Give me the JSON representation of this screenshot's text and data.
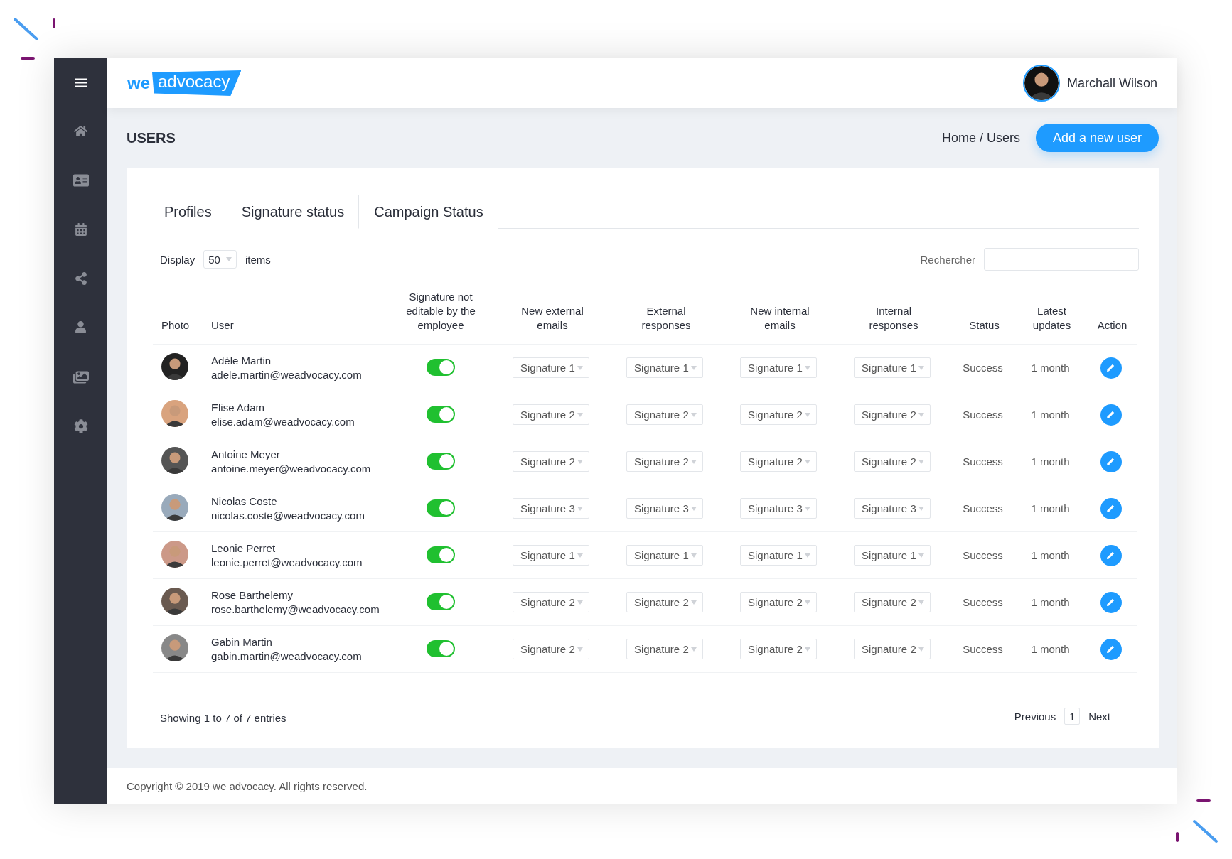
{
  "header": {
    "logo": {
      "part_1": "we",
      "part_2": "advocacy"
    },
    "user_name": "Marchall Wilson"
  },
  "page": {
    "title": "USERS",
    "breadcrumb": "Home / Users",
    "add_button": "Add a new user"
  },
  "tabs": [
    {
      "label": "Profiles",
      "selected": false
    },
    {
      "label": "Signature status",
      "selected": true
    },
    {
      "label": "Campaign Status",
      "selected": false
    }
  ],
  "display": {
    "label": "Display",
    "value": "50",
    "suffix": "items"
  },
  "search": {
    "label": "Rechercher"
  },
  "table": {
    "columns": [
      "Photo",
      "User",
      "Signature not editable by the employee",
      "New external emails",
      "External responses",
      "New internal emails",
      "Internal responses",
      "Status",
      "Latest updates",
      "Action"
    ],
    "rows": [
      {
        "name": "Adèle Martin",
        "email": "adele.martin@weadvocacy.com",
        "locked": true,
        "signatures": [
          "Signature 1",
          "Signature 1",
          "Signature 1",
          "Signature 1"
        ],
        "status": "Success",
        "updated": "1 month"
      },
      {
        "name": "Elise Adam",
        "email": "elise.adam@weadvocacy.com",
        "locked": true,
        "signatures": [
          "Signature 2",
          "Signature 2",
          "Signature 2",
          "Signature 2"
        ],
        "status": "Success",
        "updated": "1 month"
      },
      {
        "name": "Antoine Meyer",
        "email": "antoine.meyer@weadvocacy.com",
        "locked": true,
        "signatures": [
          "Signature 2",
          "Signature 2",
          "Signature 2",
          "Signature 2"
        ],
        "status": "Success",
        "updated": "1 month"
      },
      {
        "name": "Nicolas Coste",
        "email": "nicolas.coste@weadvocacy.com",
        "locked": true,
        "signatures": [
          "Signature 3",
          "Signature 3",
          "Signature 3",
          "Signature 3"
        ],
        "status": "Success",
        "updated": "1 month"
      },
      {
        "name": "Leonie Perret",
        "email": "leonie.perret@weadvocacy.com",
        "locked": true,
        "signatures": [
          "Signature 1",
          "Signature 1",
          "Signature 1",
          "Signature 1"
        ],
        "status": "Success",
        "updated": "1 month"
      },
      {
        "name": "Rose Barthelemy",
        "email": "rose.barthelemy@weadvocacy.com",
        "locked": true,
        "signatures": [
          "Signature 2",
          "Signature 2",
          "Signature 2",
          "Signature 2"
        ],
        "status": "Success",
        "updated": "1 month"
      },
      {
        "name": "Gabin Martin",
        "email": "gabin.martin@weadvocacy.com",
        "locked": true,
        "signatures": [
          "Signature 2",
          "Signature 2",
          "Signature 2",
          "Signature 2"
        ],
        "status": "Success",
        "updated": "1 month"
      }
    ]
  },
  "pagination": {
    "info": "Showing 1 to 7 of 7 entries",
    "previous": "Previous",
    "page": "1",
    "next": "Next"
  },
  "copyright": "Copyright © 2019 we advocacy. All rights reserved."
}
